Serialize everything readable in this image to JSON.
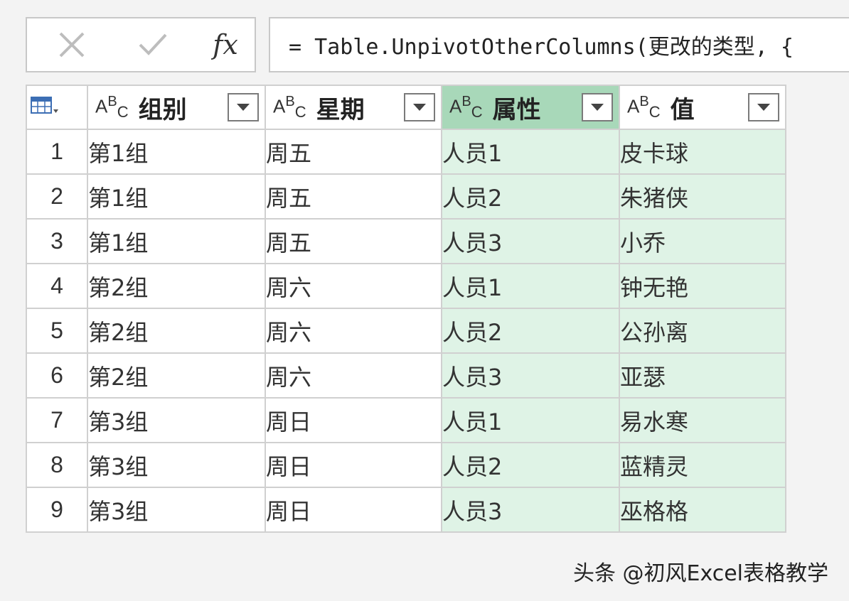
{
  "command_bar": {
    "cancel_icon": "close-icon",
    "confirm_icon": "check-icon",
    "fx_label": "fx",
    "formula": "= Table.UnpivotOtherColumns(更改的类型, {"
  },
  "table": {
    "columns": [
      {
        "type_label": "ABC",
        "name": "组别"
      },
      {
        "type_label": "ABC",
        "name": "星期"
      },
      {
        "type_label": "ABC",
        "name": "属性"
      },
      {
        "type_label": "ABC",
        "name": "值"
      }
    ],
    "rows": [
      {
        "n": "1",
        "cells": [
          "第1组",
          "周五",
          "人员1",
          "皮卡球"
        ]
      },
      {
        "n": "2",
        "cells": [
          "第1组",
          "周五",
          "人员2",
          "朱猪侠"
        ]
      },
      {
        "n": "3",
        "cells": [
          "第1组",
          "周五",
          "人员3",
          "小乔"
        ]
      },
      {
        "n": "4",
        "cells": [
          "第2组",
          "周六",
          "人员1",
          "钟无艳"
        ]
      },
      {
        "n": "5",
        "cells": [
          "第2组",
          "周六",
          "人员2",
          "公孙离"
        ]
      },
      {
        "n": "6",
        "cells": [
          "第2组",
          "周六",
          "人员3",
          "亚瑟"
        ]
      },
      {
        "n": "7",
        "cells": [
          "第3组",
          "周日",
          "人员1",
          "易水寒"
        ]
      },
      {
        "n": "8",
        "cells": [
          "第3组",
          "周日",
          "人员2",
          "蓝精灵"
        ]
      },
      {
        "n": "9",
        "cells": [
          "第3组",
          "周日",
          "人员3",
          "巫格格"
        ]
      }
    ],
    "selected_header_color": "#a8d8b9",
    "selected_cell_color": "#dff3e6"
  },
  "watermark": "头条 @初风Excel表格教学"
}
